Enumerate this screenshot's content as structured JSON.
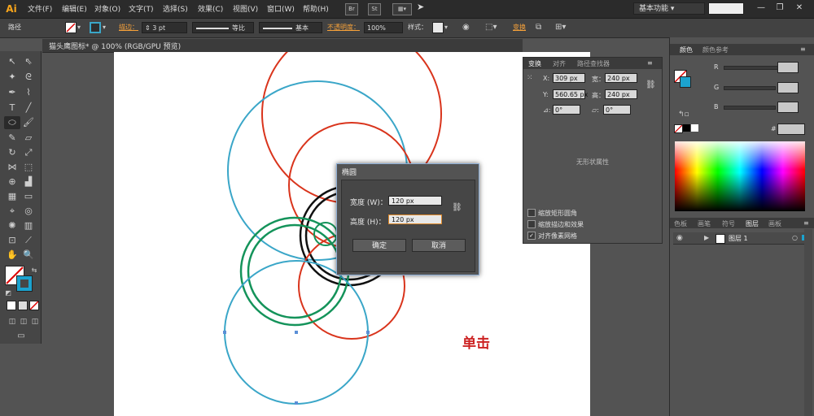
{
  "app": {
    "logo": "Ai"
  },
  "menubar": {
    "items": [
      "文件(F)",
      "编辑(E)",
      "对象(O)",
      "文字(T)",
      "选择(S)",
      "效果(C)",
      "视图(V)",
      "窗口(W)",
      "帮助(H)"
    ],
    "br_icon": "Br",
    "st_icon": "St",
    "workspace": "基本功能",
    "window_controls": [
      "—",
      "❐",
      "✕"
    ]
  },
  "control_bar": {
    "selection": "路径",
    "stroke_label": "描边：",
    "stroke_weight": "3 pt",
    "profile_label": "等比",
    "brush_label": "基本",
    "opacity_label": "不透明度：",
    "opacity_value": "100%",
    "style_label": "样式：",
    "transform_link": "变换"
  },
  "document": {
    "tab_title": "猫头鹰图标* @ 100% (RGB/GPU 预览)",
    "annotation": "单击"
  },
  "dialog": {
    "title": "椭圆",
    "width_label": "宽度 (W)：",
    "width_value": "120 px",
    "height_label": "高度 (H)：",
    "height_value": "120 px",
    "ok_label": "确定",
    "cancel_label": "取消"
  },
  "transform_panel": {
    "tabs": [
      "变换",
      "对齐",
      "路径查找器"
    ],
    "x_label": "X:",
    "x_value": "309 px",
    "y_label": "Y:",
    "y_value": "560.65 px",
    "w_label": "宽：",
    "w_value": "240 px",
    "h_label": "高：",
    "h_value": "240 px",
    "rotate_value": "0°",
    "shear_value": "0°",
    "no_shape": "无形状属性",
    "options": [
      {
        "label": "缩放矩形圆角",
        "checked": false
      },
      {
        "label": "缩放描边和效果",
        "checked": false
      },
      {
        "label": "对齐像素网格",
        "checked": true
      }
    ]
  },
  "color_panel": {
    "tabs": [
      "颜色",
      "颜色参考"
    ],
    "channels": [
      "R",
      "G",
      "B"
    ],
    "hex_symbol": "#"
  },
  "layers_panel": {
    "tabs": [
      "色板",
      "画笔",
      "符号",
      "图层",
      "画板"
    ],
    "layer_name": "图层 1"
  },
  "colors": {
    "red": "#d9341c",
    "blue": "#3aa6c8",
    "green": "#14935a",
    "black": "#111111"
  }
}
